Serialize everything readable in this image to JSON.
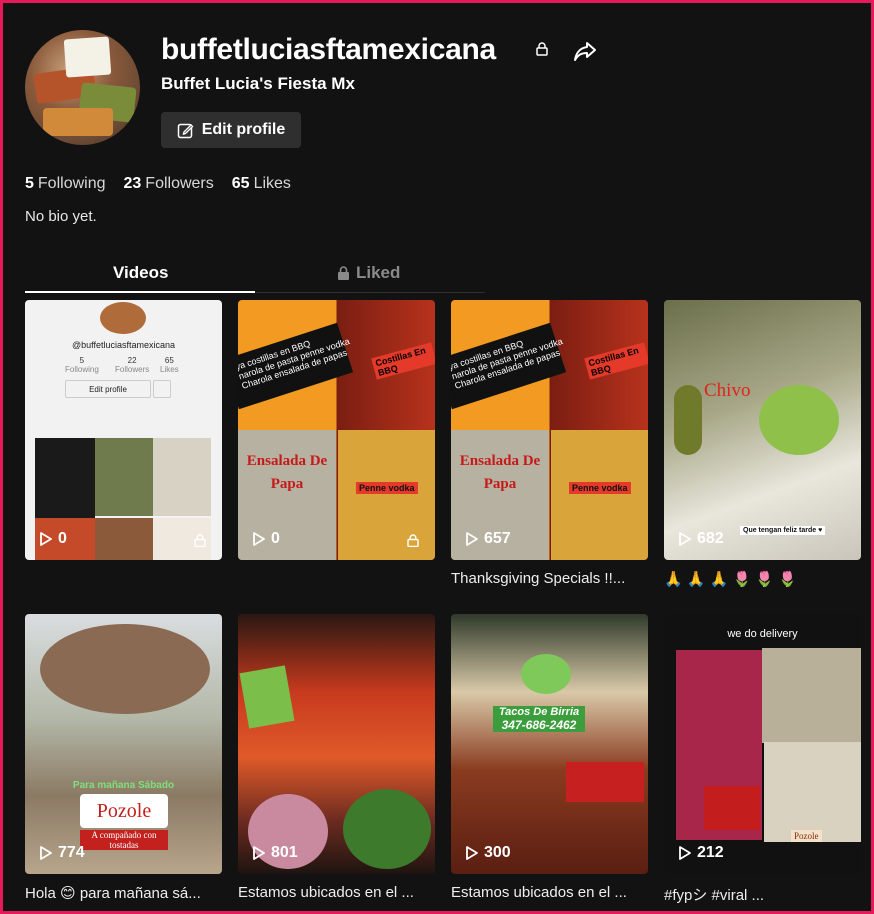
{
  "profile": {
    "username": "buffetluciasftamexicana",
    "nickname": "Buffet Lucia's Fiesta Mx",
    "edit_label": "Edit profile",
    "bio": "No bio yet."
  },
  "stats": [
    {
      "value": "5",
      "label": "Following"
    },
    {
      "value": "23",
      "label": "Followers"
    },
    {
      "value": "65",
      "label": "Likes"
    }
  ],
  "tabs": {
    "videos": "Videos",
    "liked": "Liked"
  },
  "videos": [
    {
      "views": "0",
      "caption": "",
      "private": true
    },
    {
      "views": "0",
      "caption": "",
      "private": true
    },
    {
      "views": "657",
      "caption": "Thanksgiving Specials !!...",
      "private": false
    },
    {
      "views": "682",
      "caption": "🙏 🙏 🙏 🌷 🌷 🌷",
      "private": false
    },
    {
      "views": "774",
      "caption": "Hola 😊 para mañana sá...",
      "private": false
    },
    {
      "views": "801",
      "caption": "Estamos ubicados en el ...",
      "private": false
    },
    {
      "views": "300",
      "caption": "Estamos ubicados en el ...",
      "private": false
    },
    {
      "views": "212",
      "caption": "#fypシ #viral ...",
      "private": false
    }
  ],
  "thumb_text": {
    "t1_handle": "@buffetluciasftamexicana",
    "t1_following": "5",
    "t1_followers": "22",
    "t1_likes": "65",
    "t1_following_lbl": "Following",
    "t1_followers_lbl": "Followers",
    "t1_likes_lbl": "Likes",
    "t1_edit": "Edit profile",
    "t2_costillas": "Costillas En BBQ",
    "t2_ensalada": "Ensalada De Papa",
    "t2_penne": "Penne vodka",
    "t2_menu": "ya costillas en BBQ\nnarola de pasta penne vodka\nCharola ensalada de papas",
    "t4_chivo": "Chivo",
    "t4_tarde": "Que tengan feliz tarde ♥",
    "t5_manana": "Para mañana Sábado",
    "t5_pozole": "Pozole",
    "t5_acomp": "A compañado con tostadas",
    "t7_tacos": "Tacos De Birria",
    "t7_phone": "347-686-2462",
    "t8_delivery": "we do delivery",
    "t8_pozole": "Pozole"
  },
  "colors": {
    "accent_border": "#e6195a",
    "bg": "#121212",
    "button": "#2f2f2f"
  }
}
